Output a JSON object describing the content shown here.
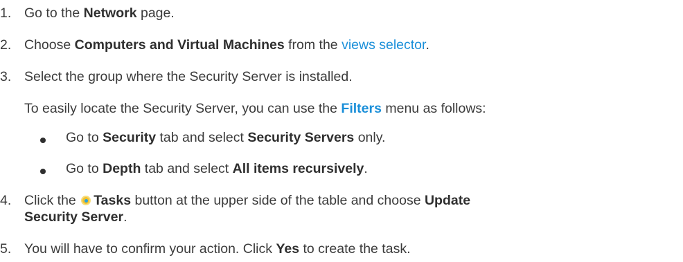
{
  "steps": [
    {
      "num": "1.",
      "pre": "Go to the ",
      "bold": "Network",
      "post": " page."
    },
    {
      "num": "2.",
      "pre": "Choose ",
      "bold": "Computers and Virtual Machines",
      "mid": " from the ",
      "link": "views selector",
      "post": "."
    },
    {
      "num": "3.",
      "text": "Select the group where the Security Server is installed."
    },
    {
      "num": "4.",
      "pre": "Click the ",
      "bold": "Tasks",
      "mid": " button at the upper side of the table and choose ",
      "bold2": "Update",
      "bold3": "Security Server",
      "post": "."
    },
    {
      "num": "5.",
      "pre": "You will have to confirm your action. Click ",
      "bold": "Yes",
      "post": " to create the task."
    }
  ],
  "note": {
    "pre": "To easily locate the Security Server, you can use the ",
    "link_bold": "Filters",
    "post": " menu as follows:"
  },
  "bullets": [
    {
      "pre": "Go to ",
      "bold": "Security",
      "mid": " tab and select ",
      "bold2": "Security Servers",
      "post": " only."
    },
    {
      "pre": "Go to ",
      "bold": "Depth",
      "mid": " tab and select ",
      "bold2": "All items recursively",
      "post": "."
    }
  ],
  "icons": {
    "tasks": "tasks-icon"
  },
  "colors": {
    "text": "#3b3b3b",
    "link": "#1a8fd9"
  }
}
